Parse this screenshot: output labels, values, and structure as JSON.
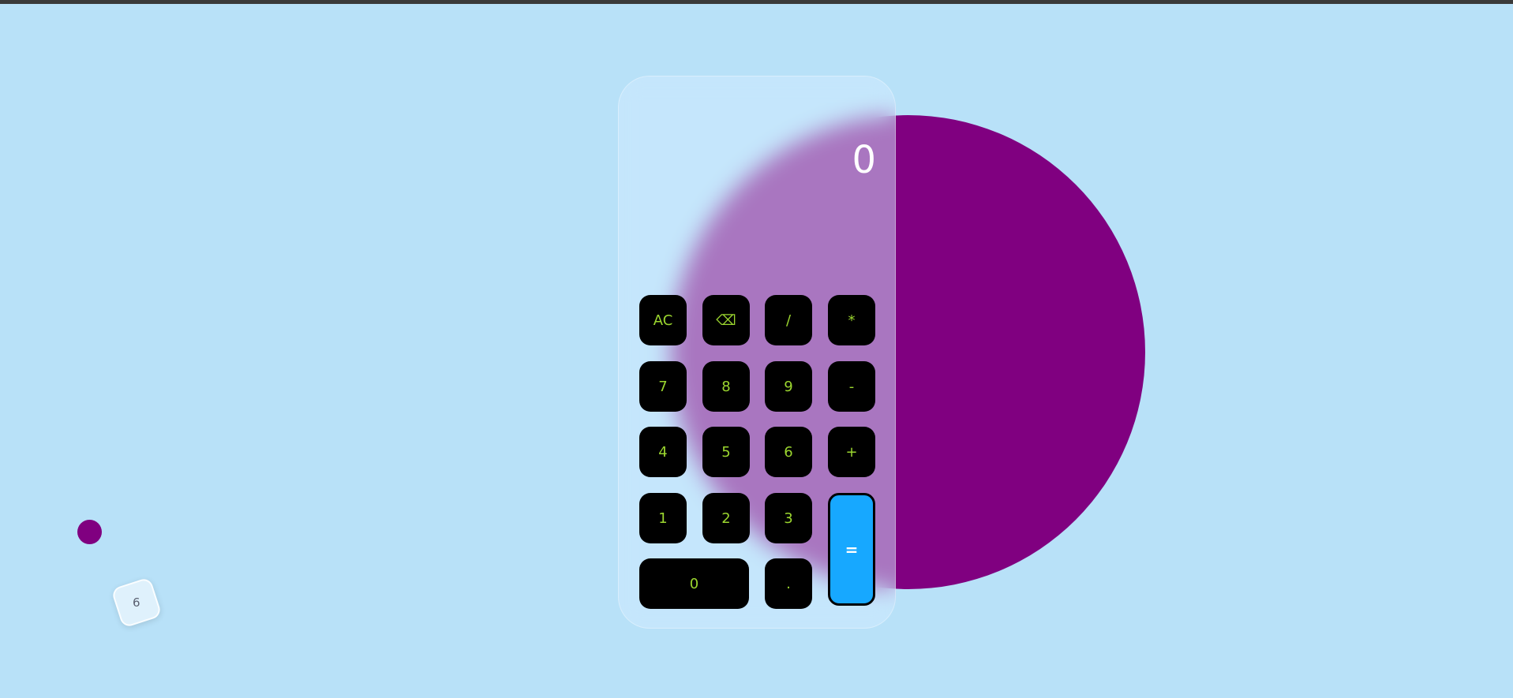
{
  "colors": {
    "background": "#b8e1f8",
    "circle": "#800080",
    "key_background": "#000000",
    "key_text": "#9bd62f",
    "equals_background": "#17a8ff",
    "display_text": "#ffffff"
  },
  "display": {
    "value": "0"
  },
  "keys": {
    "ac": "AC",
    "backspace": "⌫",
    "divide": "/",
    "multiply": "*",
    "seven": "7",
    "eight": "8",
    "nine": "9",
    "subtract": "-",
    "four": "4",
    "five": "5",
    "six": "6",
    "add": "+",
    "one": "1",
    "two": "2",
    "three": "3",
    "equals": "=",
    "zero": "0",
    "decimal": "."
  },
  "dice": {
    "value": "6"
  }
}
